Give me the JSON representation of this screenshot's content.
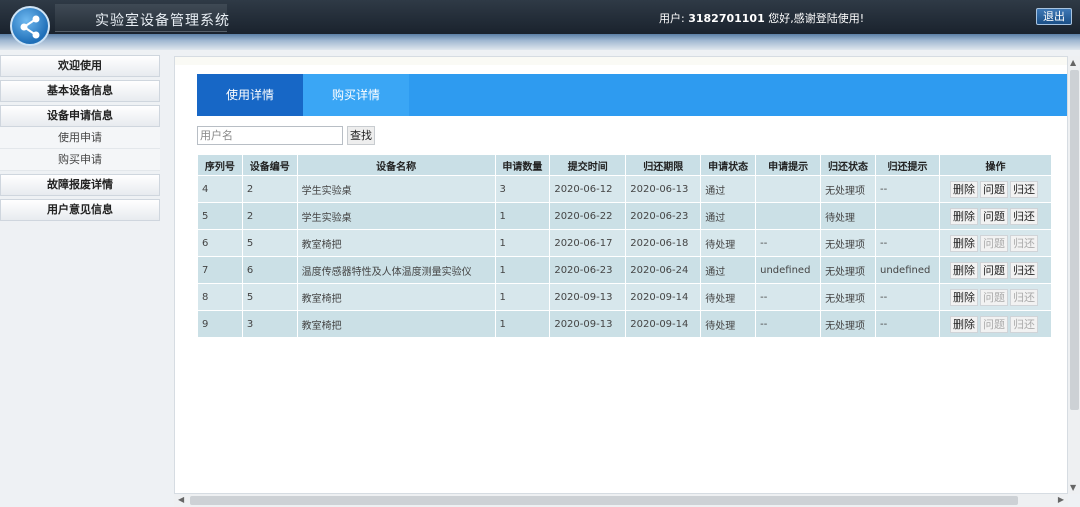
{
  "header": {
    "app_title": "实验室设备管理系统",
    "user_prefix": "用户: ",
    "user_id": "3182701101",
    "greeting": " 您好,感谢登陆使用!",
    "logout_label": "退出"
  },
  "sidebar": {
    "items": [
      {
        "label": "欢迎使用"
      },
      {
        "label": "基本设备信息"
      },
      {
        "label": "设备申请信息"
      },
      {
        "label": "使用申请"
      },
      {
        "label": "购买申请"
      },
      {
        "label": "故障报废详情"
      },
      {
        "label": "用户意见信息"
      }
    ]
  },
  "tabs": [
    {
      "label": "使用详情",
      "active": true
    },
    {
      "label": "购买详情",
      "active": false
    }
  ],
  "search": {
    "placeholder": "用户名",
    "button_label": "查找"
  },
  "table": {
    "headers": [
      "序列号",
      "设备编号",
      "设备名称",
      "申请数量",
      "提交时间",
      "归还期限",
      "申请状态",
      "申请提示",
      "归还状态",
      "归还提示",
      "操作"
    ],
    "rows": [
      {
        "cells": [
          "4",
          "2",
          "学生实验桌",
          "3",
          "2020-06-12",
          "2020-06-13",
          "通过",
          "",
          "无处理项",
          "--"
        ],
        "question_enabled": true,
        "return_enabled": true
      },
      {
        "cells": [
          "5",
          "2",
          "学生实验桌",
          "1",
          "2020-06-22",
          "2020-06-23",
          "通过",
          "",
          "待处理",
          ""
        ],
        "question_enabled": true,
        "return_enabled": true
      },
      {
        "cells": [
          "6",
          "5",
          "教室椅把",
          "1",
          "2020-06-17",
          "2020-06-18",
          "待处理",
          "--",
          "无处理项",
          "--"
        ],
        "question_enabled": false,
        "return_enabled": false
      },
      {
        "cells": [
          "7",
          "6",
          "温度传感器特性及人体温度测量实验仪",
          "1",
          "2020-06-23",
          "2020-06-24",
          "通过",
          "undefined",
          "无处理项",
          "undefined"
        ],
        "question_enabled": true,
        "return_enabled": true
      },
      {
        "cells": [
          "8",
          "5",
          "教室椅把",
          "1",
          "2020-09-13",
          "2020-09-14",
          "待处理",
          "--",
          "无处理项",
          "--"
        ],
        "question_enabled": false,
        "return_enabled": false
      },
      {
        "cells": [
          "9",
          "3",
          "教室椅把",
          "1",
          "2020-09-13",
          "2020-09-14",
          "待处理",
          "--",
          "无处理项",
          "--"
        ],
        "question_enabled": false,
        "return_enabled": false
      }
    ],
    "op_labels": {
      "delete": "删除",
      "question": "问题",
      "return": "归还"
    }
  }
}
